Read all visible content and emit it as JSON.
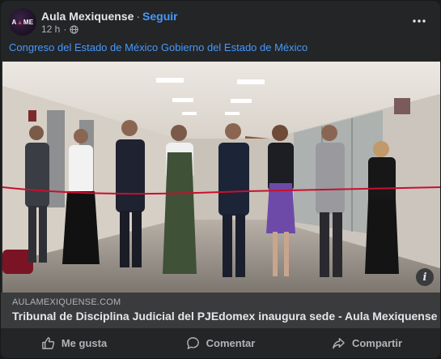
{
  "post": {
    "author": "Aula Mexiquense",
    "follow_label": "Seguir",
    "separator": "·",
    "time": "12 h",
    "avatar_text": "AME",
    "caption": "Congreso del Estado de México Gobierno del Estado de México",
    "link": {
      "domain": "AULAMEXIQUENSE.COM",
      "title": "Tribunal de Disciplina Judicial del PJEdomex inaugura sede - Aula Mexiquense"
    },
    "actions": {
      "like": "Me gusta",
      "comment": "Comentar",
      "share": "Compartir"
    },
    "icons": {
      "privacy": "globe-icon",
      "menu": "more-horizontal-icon",
      "info": "info-icon",
      "like": "thumbs-up-icon",
      "comment": "comment-icon",
      "share": "share-icon"
    }
  },
  "colors": {
    "background": "#18191a",
    "card": "#242526",
    "link_blue": "#4599ff",
    "text_primary": "#e4e6eb",
    "text_secondary": "#b0b3b8",
    "link_bar": "#3a3b3c",
    "ribbon": "#c8102e"
  }
}
